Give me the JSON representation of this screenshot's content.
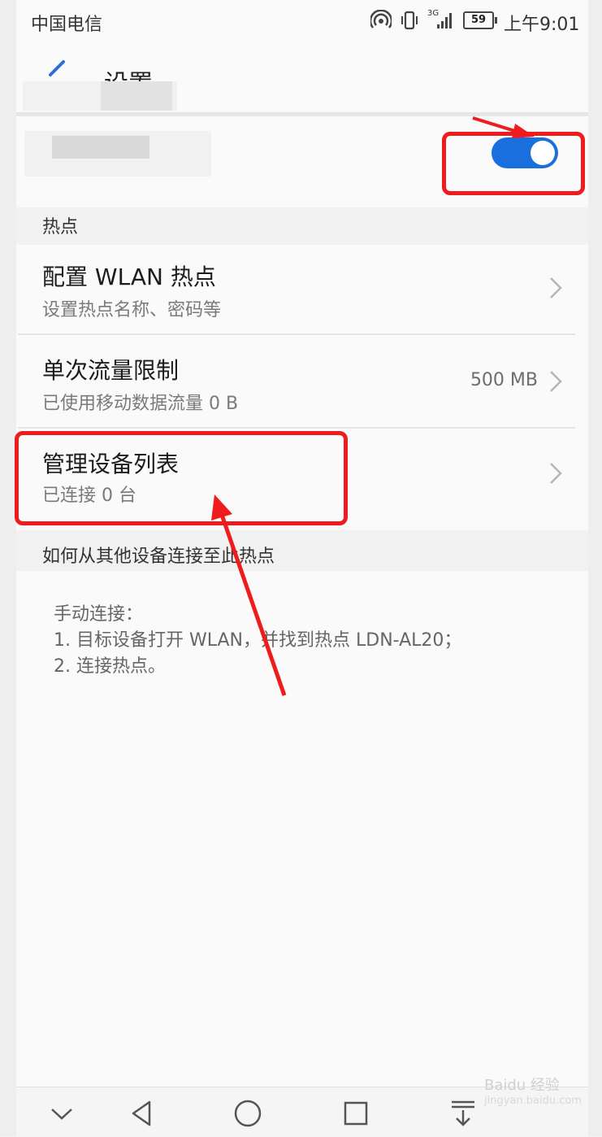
{
  "status_bar": {
    "carrier": "中国电信",
    "network": "3G",
    "battery": "59",
    "time": "上午9:01"
  },
  "header": {
    "title": "设置",
    "back_icon": "back-arrow-icon"
  },
  "hotspot_toggle": {
    "on": true,
    "accent": "#1a6fdf"
  },
  "sections": {
    "hotspot_header": "热点",
    "connect_header": "如何从其他设备连接至此热点"
  },
  "items": {
    "configure": {
      "title": "配置 WLAN 热点",
      "subtitle": "设置热点名称、密码等"
    },
    "data_limit": {
      "title": "单次流量限制",
      "subtitle": "已使用移动数据流量 0 B",
      "value": "500 MB"
    },
    "devices": {
      "title": "管理设备列表",
      "subtitle": "已连接 0 台"
    }
  },
  "instructions": {
    "line1": "手动连接：",
    "line2": "1. 目标设备打开 WLAN，并找到热点 LDN-AL20；",
    "line3": "2. 连接热点。"
  },
  "nav": {
    "icons": [
      "chevron-down-icon",
      "back-triangle-icon",
      "home-circle-icon",
      "recents-square-icon",
      "notification-pull-icon"
    ]
  },
  "watermark": {
    "brand": "Baidu 经验",
    "url": "jingyan.baidu.com"
  },
  "annotation_color": "#ee1c1c"
}
